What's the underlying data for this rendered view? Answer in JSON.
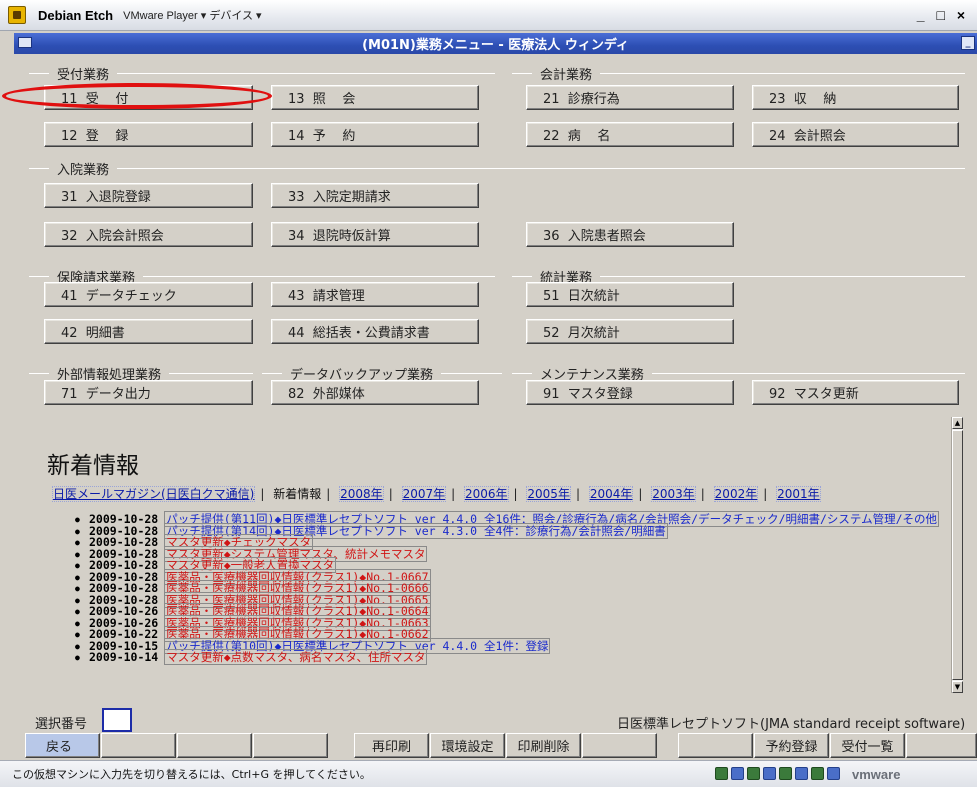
{
  "vmware": {
    "window_title": "Debian Etch",
    "menu": "VMware Player ▾ デバイス ▾",
    "window_controls": "_ □ ×",
    "brand": "vmware",
    "status_text": "この仮想マシンに入力先を切り替えるには、Ctrl+G を押してください。"
  },
  "app": {
    "title": "(M01N)業務メニュー - 医療法人 ウィンディ",
    "sections": {
      "uketsuke": "受付業務",
      "kaikei": "会計業務",
      "nyuin": "入院業務",
      "hoken": "保険請求業務",
      "toukei": "統計業務",
      "gaibu": "外部情報処理業務",
      "backup": "データバックアップ業務",
      "maint": "メンテナンス業務"
    },
    "buttons": {
      "b11": "11  受    付",
      "b13": "13  照    会",
      "b21": "21  診療行為",
      "b23": "23  収    納",
      "b12": "12  登    録",
      "b14": "14  予    約",
      "b22": "22  病    名",
      "b24": "24  会計照会",
      "b31": "31  入退院登録",
      "b33": "33  入院定期請求",
      "b32": "32  入院会計照会",
      "b34": "34  退院時仮計算",
      "b36": "36  入院患者照会",
      "b41": "41  データチェック",
      "b43": "43  請求管理",
      "b51": "51  日次統計",
      "b42": "42  明細書",
      "b44": "44  総括表・公費請求書",
      "b52": "52  月次統計",
      "b71": "71  データ出力",
      "b82": "82  外部媒体",
      "b91": "91  マスタ登録",
      "b92": "92  マスタ更新"
    },
    "news": {
      "title": "新着情報",
      "links": [
        "日医メールマガジン(日医白クマ通信)",
        "新着情報",
        "2008年",
        "2007年",
        "2006年",
        "2005年",
        "2004年",
        "2003年",
        "2002年",
        "2001年"
      ],
      "items": [
        {
          "date": "2009-10-28",
          "text": "パッチ提供(第11回)◆日医標準レセプトソフト ver 4.4.0 全16件：照会/診療行為/病名/会計照会/データチェック/明細書/システム管理/その他",
          "color": "#1a2acc"
        },
        {
          "date": "2009-10-28",
          "text": "パッチ提供(第14回)◆日医標準レセプトソフト ver 4.3.0 全4件：診療行為/会計照会/明細書",
          "color": "#1a2acc"
        },
        {
          "date": "2009-10-28",
          "text": "マスタ更新◆チェックマスタ",
          "color": "#d01515"
        },
        {
          "date": "2009-10-28",
          "text": "マスタ更新◆システム管理マスタ、統計メモマスタ",
          "color": "#d01515"
        },
        {
          "date": "2009-10-28",
          "text": "マスタ更新◆一般老人置換マスタ",
          "color": "#d01515"
        },
        {
          "date": "2009-10-28",
          "text": "医薬品・医療機器回収情報(クラス1)◆No.1-0667",
          "color": "#d01515"
        },
        {
          "date": "2009-10-28",
          "text": "医薬品・医療機器回収情報(クラス1)◆No.1-0666",
          "color": "#d01515"
        },
        {
          "date": "2009-10-28",
          "text": "医薬品・医療機器回収情報(クラス1)◆No.1-0665",
          "color": "#d01515"
        },
        {
          "date": "2009-10-26",
          "text": "医薬品・医療機器回収情報(クラス1)◆No.1-0664",
          "color": "#d01515"
        },
        {
          "date": "2009-10-26",
          "text": "医薬品・医療機器回収情報(クラス1)◆No.1-0663",
          "color": "#d01515"
        },
        {
          "date": "2009-10-22",
          "text": "医薬品・医療機器回収情報(クラス1)◆No.1-0662",
          "color": "#d01515"
        },
        {
          "date": "2009-10-15",
          "text": "パッチ提供(第10回)◆日医標準レセプトソフト ver 4.4.0 全1件：登録",
          "color": "#1a2acc"
        },
        {
          "date": "2009-10-14",
          "text": "マスタ更新◆点数マスタ、病名マスタ、住所マスタ",
          "color": "#d01515"
        }
      ]
    },
    "selection_label": "選択番号",
    "selection_value": "",
    "product_name": "日医標準レセプトソフト(JMA standard receipt software)",
    "fkeys": {
      "back": "戻る",
      "reprint": "再印刷",
      "env": "環境設定",
      "print_delete": "印刷削除",
      "reservation": "予約登録",
      "reception_list": "受付一覧"
    }
  }
}
